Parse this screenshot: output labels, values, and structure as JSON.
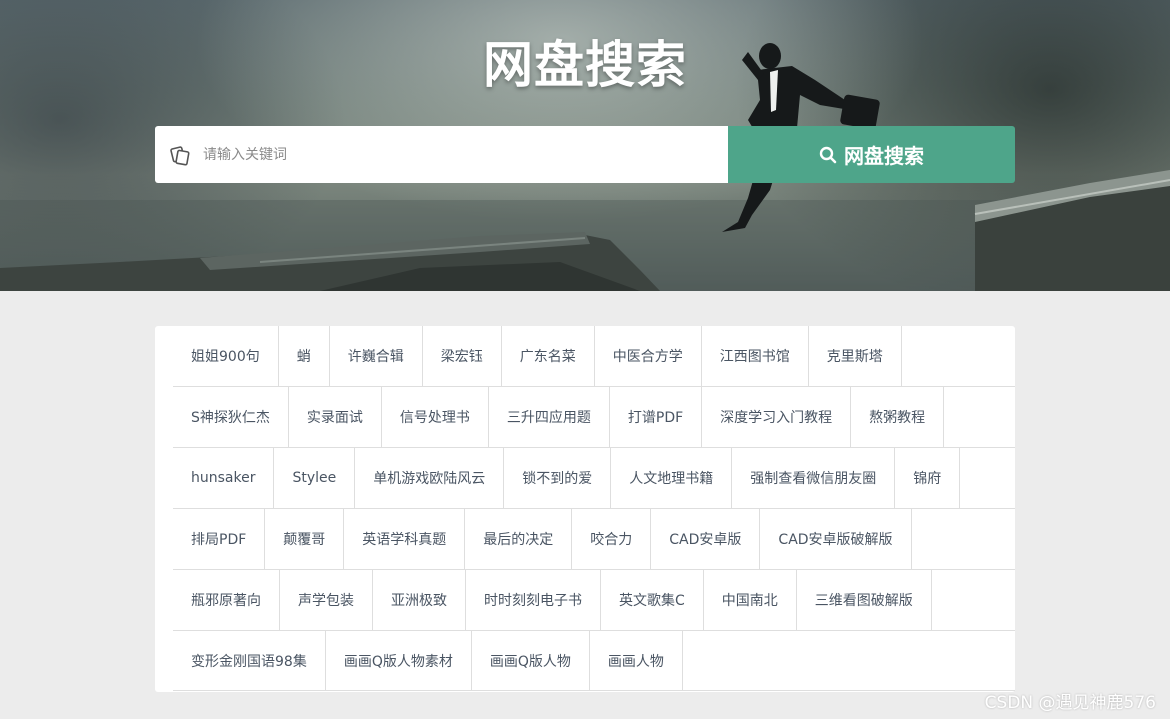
{
  "header": {
    "title": "网盘搜索"
  },
  "search": {
    "placeholder": "请输入关键词",
    "value": "",
    "button_label": "网盘搜索",
    "button_color": "#4ea58a"
  },
  "tags": {
    "rows": [
      [
        "姐姐900句",
        "蛸",
        "许巍合辑",
        "梁宏钰",
        "广东名菜",
        "中医合方学",
        "江西图书馆",
        "克里斯塔"
      ],
      [
        "S神探狄仁杰",
        "实录面试",
        "信号处理书",
        "三升四应用题",
        "打谱PDF",
        "深度学习入门教程",
        "熬粥教程"
      ],
      [
        "hunsaker",
        "Stylee",
        "单机游戏欧陆风云",
        "锁不到的爱",
        "人文地理书籍",
        "强制查看微信朋友圈",
        "锦府"
      ],
      [
        "排局PDF",
        "颠覆哥",
        "英语学科真题",
        "最后的决定",
        "咬合力",
        "CAD安卓版",
        "CAD安卓版破解版"
      ],
      [
        "瓶邪原著向",
        "声学包装",
        "亚洲极致",
        "时时刻刻电子书",
        "英文歌集C",
        "中国南北",
        "三维看图破解版"
      ],
      [
        "变形金刚国语98集",
        "画画Q版人物素材",
        "画画Q版人物",
        "画画人物"
      ]
    ]
  },
  "watermark": {
    "text": "CSDN @遇见神鹿576"
  },
  "icons": {
    "input_icon": "keyword-tag-icon",
    "button_icon": "search-icon"
  }
}
